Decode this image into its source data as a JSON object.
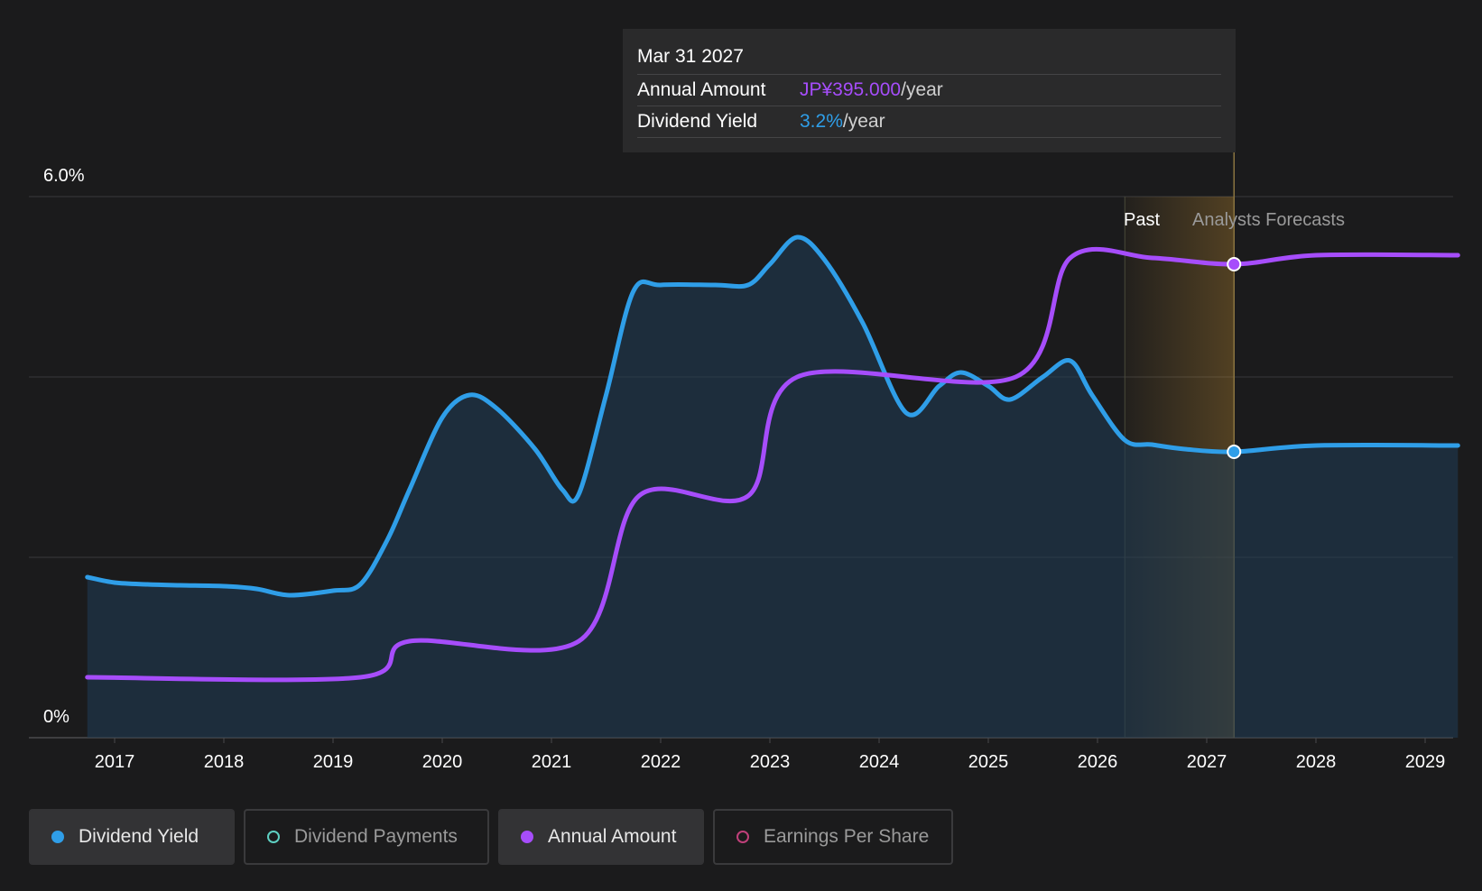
{
  "chart_data": {
    "type": "line",
    "x_ticks": [
      "2017",
      "2018",
      "2019",
      "2020",
      "2021",
      "2022",
      "2023",
      "2024",
      "2025",
      "2026",
      "2027",
      "2028",
      "2029"
    ],
    "y_ticks": {
      "top": "6.0%",
      "bottom": "0%"
    },
    "ylim": [
      0,
      6.0
    ],
    "region_labels": {
      "past": "Past",
      "forecast": "Analysts Forecasts"
    },
    "series": [
      {
        "name": "Dividend Yield",
        "color": "#2f9ee8",
        "points": [
          [
            2016.75,
            1.78
          ],
          [
            2017.0,
            1.72
          ],
          [
            2017.3,
            1.7
          ],
          [
            2017.6,
            1.69
          ],
          [
            2018.0,
            1.68
          ],
          [
            2018.3,
            1.65
          ],
          [
            2018.6,
            1.58
          ],
          [
            2019.0,
            1.63
          ],
          [
            2019.25,
            1.7
          ],
          [
            2019.5,
            2.2
          ],
          [
            2019.7,
            2.75
          ],
          [
            2020.0,
            3.55
          ],
          [
            2020.25,
            3.8
          ],
          [
            2020.5,
            3.65
          ],
          [
            2020.85,
            3.2
          ],
          [
            2021.1,
            2.75
          ],
          [
            2021.25,
            2.7
          ],
          [
            2021.5,
            3.8
          ],
          [
            2021.75,
            4.95
          ],
          [
            2022.0,
            5.02
          ],
          [
            2022.5,
            5.02
          ],
          [
            2022.8,
            5.02
          ],
          [
            2023.0,
            5.25
          ],
          [
            2023.25,
            5.55
          ],
          [
            2023.5,
            5.3
          ],
          [
            2023.85,
            4.6
          ],
          [
            2024.25,
            3.6
          ],
          [
            2024.55,
            3.9
          ],
          [
            2024.75,
            4.05
          ],
          [
            2025.0,
            3.9
          ],
          [
            2025.2,
            3.75
          ],
          [
            2025.5,
            4.0
          ],
          [
            2025.75,
            4.18
          ],
          [
            2025.95,
            3.8
          ],
          [
            2026.25,
            3.3
          ],
          [
            2026.5,
            3.25
          ],
          [
            2026.8,
            3.2
          ],
          [
            2027.25,
            3.17
          ],
          [
            2028.0,
            3.24
          ],
          [
            2029.3,
            3.24
          ]
        ]
      },
      {
        "name": "Annual Amount",
        "color": "#a64dfb",
        "points": [
          [
            2016.75,
            0.67
          ],
          [
            2019.25,
            0.67
          ],
          [
            2019.7,
            1.07
          ],
          [
            2021.25,
            1.07
          ],
          [
            2021.8,
            2.68
          ],
          [
            2022.8,
            2.68
          ],
          [
            2023.25,
            4.0
          ],
          [
            2025.25,
            4.0
          ],
          [
            2025.75,
            5.32
          ],
          [
            2026.5,
            5.32
          ],
          [
            2027.25,
            5.25
          ],
          [
            2028.0,
            5.35
          ],
          [
            2029.3,
            5.35
          ]
        ]
      }
    ],
    "hover_x": 2027.25
  },
  "tooltip": {
    "date": "Mar 31 2027",
    "rows": [
      {
        "label": "Annual Amount",
        "value": "JP¥395.000",
        "unit": "/year",
        "color": "#a64dfb"
      },
      {
        "label": "Dividend Yield",
        "value": "3.2%",
        "unit": "/year",
        "color": "#2f9ee8"
      }
    ]
  },
  "legend": [
    {
      "label": "Dividend Yield",
      "color": "#2f9ee8",
      "active": true,
      "filled": true
    },
    {
      "label": "Dividend Payments",
      "color": "#5ed0c2",
      "active": false,
      "filled": false
    },
    {
      "label": "Annual Amount",
      "color": "#a64dfb",
      "active": true,
      "filled": true
    },
    {
      "label": "Earnings Per Share",
      "color": "#c0407a",
      "active": false,
      "filled": false
    }
  ]
}
